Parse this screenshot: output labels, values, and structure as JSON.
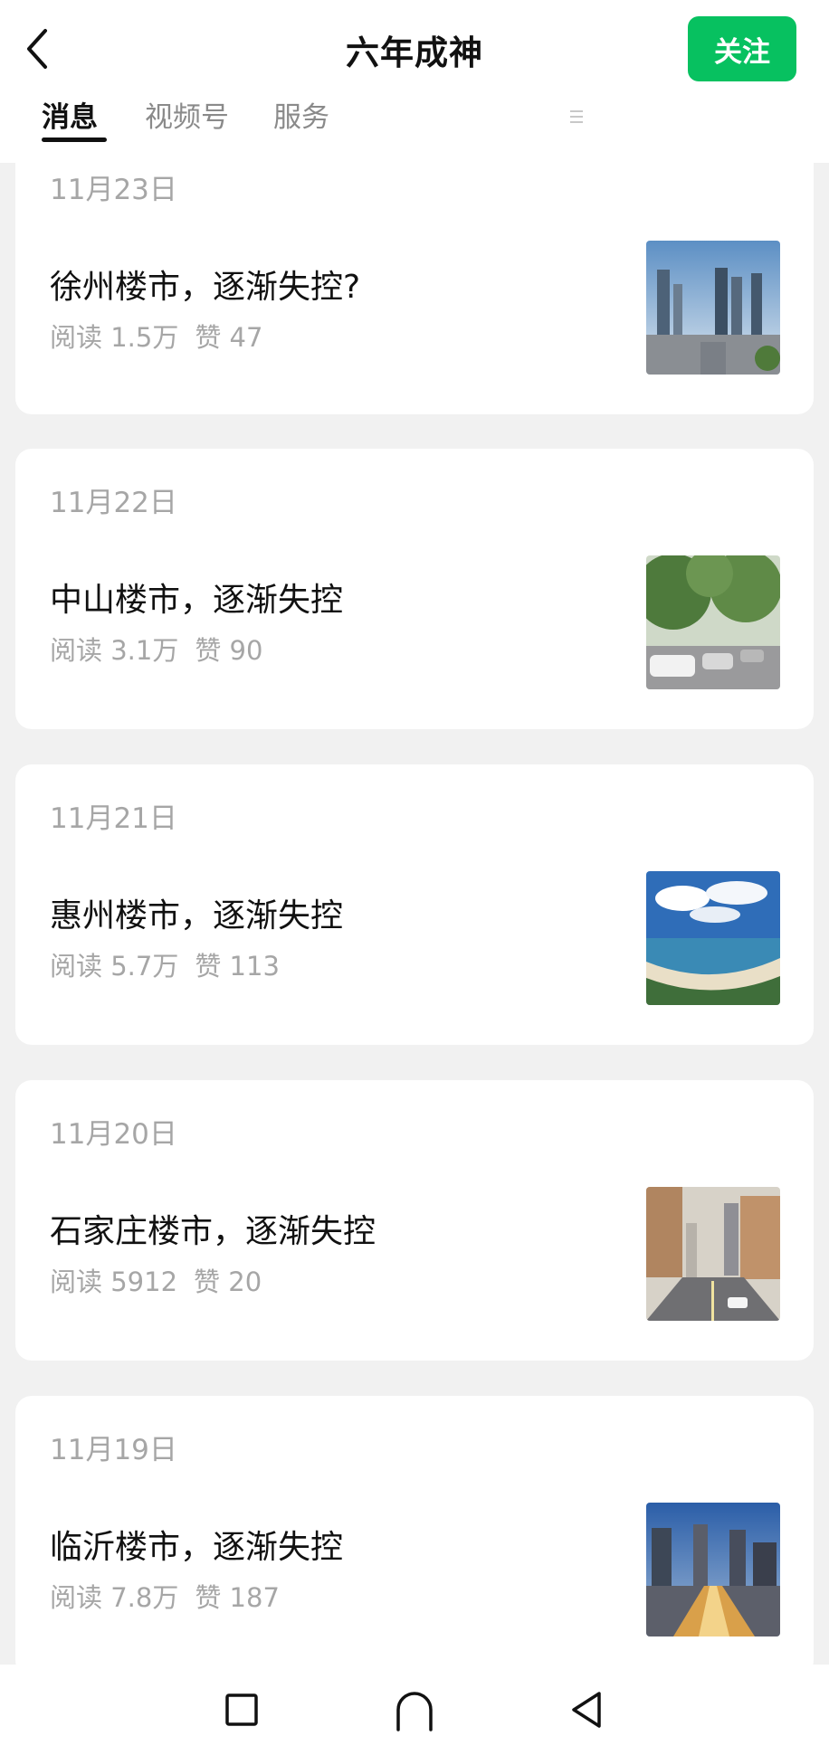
{
  "header": {
    "back_icon": "chevron-left-icon",
    "title": "六年成神",
    "follow_label": "关注",
    "accent_color": "#07c160",
    "tabs": [
      {
        "label": "消息",
        "active": true
      },
      {
        "label": "视频号",
        "active": false
      },
      {
        "label": "服务",
        "active": false
      }
    ],
    "menu_icon": "menu-lines-icon"
  },
  "articles": [
    {
      "date": "11月23日",
      "title": "徐州楼市，逐渐失控?",
      "reads": "阅读 1.5万",
      "likes": "赞 47",
      "thumbnail": "city-skyline-image"
    },
    {
      "date": "11月22日",
      "title": "中山楼市，逐渐失控",
      "reads": "阅读 3.1万",
      "likes": "赞 90",
      "thumbnail": "tree-lined-street-image"
    },
    {
      "date": "11月21日",
      "title": "惠州楼市，逐渐失控",
      "reads": "阅读 5.7万",
      "likes": "赞 113",
      "thumbnail": "coastal-bay-image"
    },
    {
      "date": "11月20日",
      "title": "石家庄楼市，逐渐失控",
      "reads": "阅读 5912",
      "likes": "赞 20",
      "thumbnail": "city-avenue-image"
    },
    {
      "date": "11月19日",
      "title": "临沂楼市，逐渐失控",
      "reads": "阅读 7.8万",
      "likes": "赞 187",
      "thumbnail": "night-city-image"
    }
  ],
  "bottom_nav": {
    "icons": [
      "square-icon",
      "home-arch-icon",
      "back-triangle-icon"
    ]
  }
}
